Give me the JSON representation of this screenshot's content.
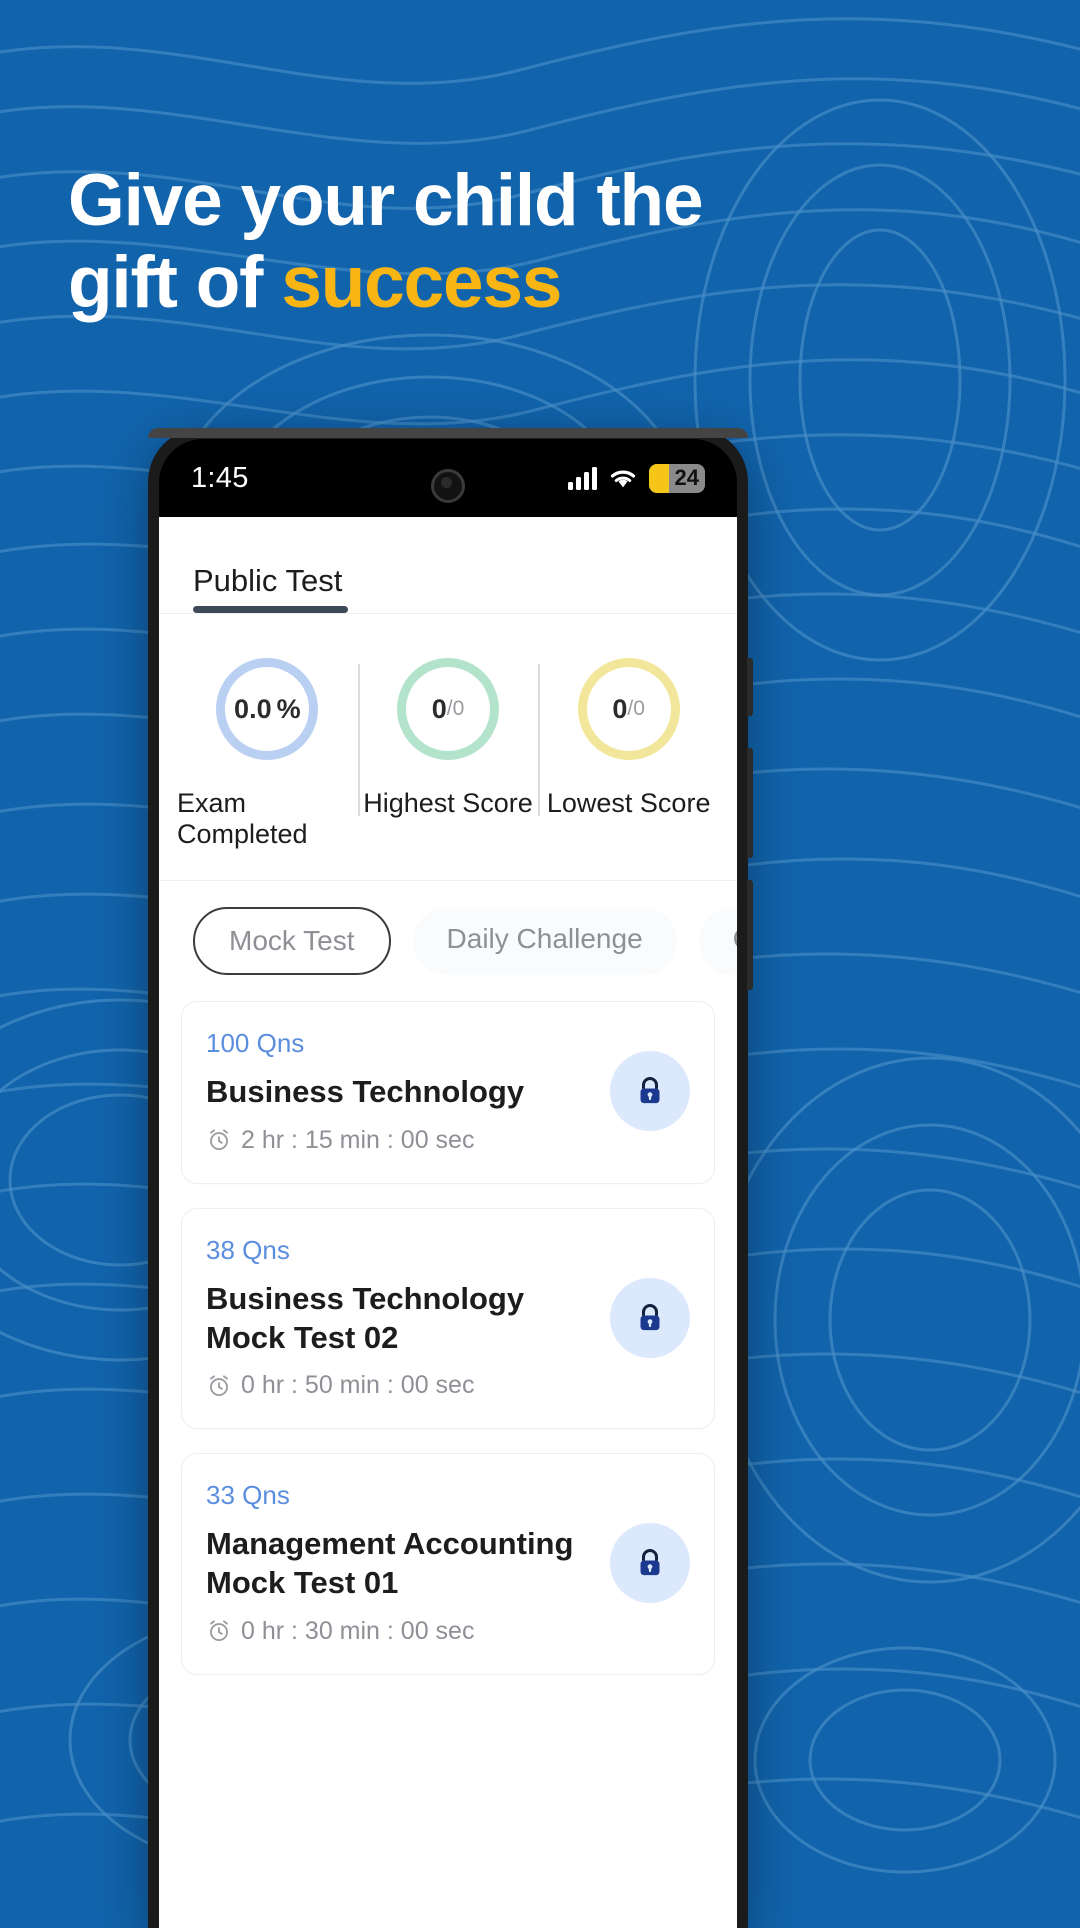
{
  "background": {
    "color": "#1163ab",
    "contour_color": "#3d85c0",
    "pattern": "topographic-contour-lines"
  },
  "headline": {
    "line1": "Give your child the",
    "line2_plain": "gift of ",
    "line2_accent": "success",
    "white": "#ffffff",
    "accent_color": "#f9b514"
  },
  "phone": {
    "statusbar": {
      "time": "1:45",
      "signal_icon": "signal-bars-icon",
      "wifi_icon": "wifi-icon",
      "battery_level": "24",
      "battery_color": "#f5c518",
      "camera_icon": "front-camera-punchhole"
    },
    "tabs": [
      {
        "label": "Public Test",
        "active": true
      }
    ],
    "stats": [
      {
        "value": "0.0",
        "unit": "%",
        "denominator": "",
        "caption": "Exam Completed",
        "ring_color": "#b9d0f3"
      },
      {
        "value": "0",
        "unit": "",
        "denominator": "/0",
        "caption": "Highest Score",
        "ring_color": "#b4e3cb"
      },
      {
        "value": "0",
        "unit": "",
        "denominator": "/0",
        "caption": "Lowest Score",
        "ring_color": "#f2e69a"
      }
    ],
    "chips": [
      {
        "label": "Mock Test",
        "active": true
      },
      {
        "label": "Daily Challenge",
        "active": false
      },
      {
        "label": "Coming",
        "active": false
      }
    ],
    "cards": [
      {
        "qns": "100 Qns",
        "title": "Business  Technology",
        "time": "2 hr : 15 min : 00 sec",
        "lock_icon": "lock-icon"
      },
      {
        "qns": "38 Qns",
        "title": "Business Technology Mock Test 02",
        "time": "0 hr : 50 min : 00 sec",
        "lock_icon": "lock-icon"
      },
      {
        "qns": "33 Qns",
        "title": "Management Accounting Mock Test 01",
        "time": "0 hr : 30 min : 00 sec",
        "lock_icon": "lock-icon"
      }
    ],
    "clock_icon": "alarm-clock-icon"
  }
}
